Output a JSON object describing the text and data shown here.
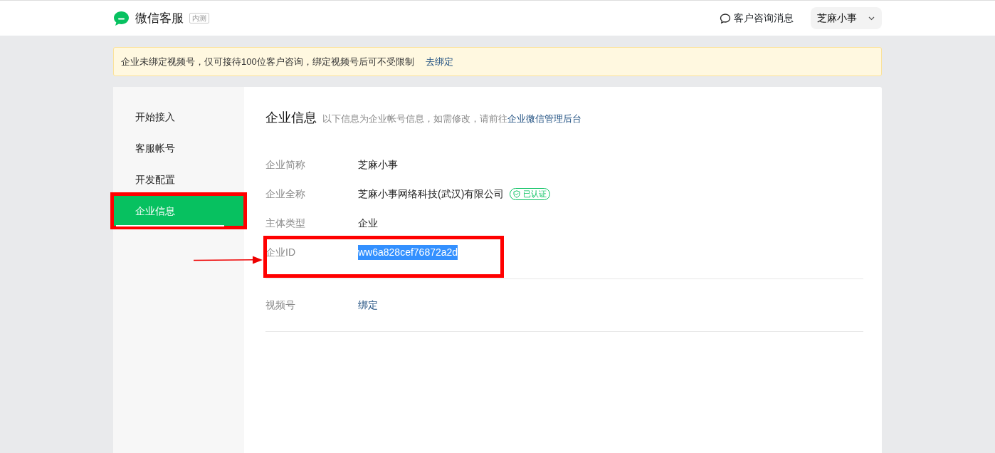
{
  "header": {
    "product": "微信客服",
    "badge": "内测",
    "messages_link": "客户咨询消息",
    "account": "芝麻小事"
  },
  "notice": {
    "text": "企业未绑定视频号，仅可接待100位客户咨询，绑定视频号后可不受限制",
    "link": "去绑定"
  },
  "sidebar": {
    "items": [
      {
        "label": "开始接入",
        "selected": false,
        "annotated": false
      },
      {
        "label": "客服帐号",
        "selected": false,
        "annotated": false
      },
      {
        "label": "开发配置",
        "selected": false,
        "annotated": false
      },
      {
        "label": "企业信息",
        "selected": true,
        "annotated": true
      }
    ]
  },
  "section": {
    "title": "企业信息",
    "description": "以下信息为企业帐号信息，如需修改，请前往",
    "description_link": "企业微信管理后台"
  },
  "fields": [
    {
      "label": "企业简称",
      "value": "芝麻小事",
      "highlighted": false,
      "annotated": false
    },
    {
      "label": "企业全称",
      "value": "芝麻小事网络科技(武汉)有限公司",
      "tag": "已认证",
      "highlighted": false,
      "annotated": false
    },
    {
      "label": "主体类型",
      "value": "企业",
      "highlighted": false,
      "annotated": false
    },
    {
      "label": "企业ID",
      "value": "ww6a828cef76872a2d",
      "highlighted": true,
      "annotated": true
    }
  ],
  "extra_fields": [
    {
      "label": "视频号",
      "value": "绑定",
      "highlighted": false,
      "annotated": false
    }
  ]
}
